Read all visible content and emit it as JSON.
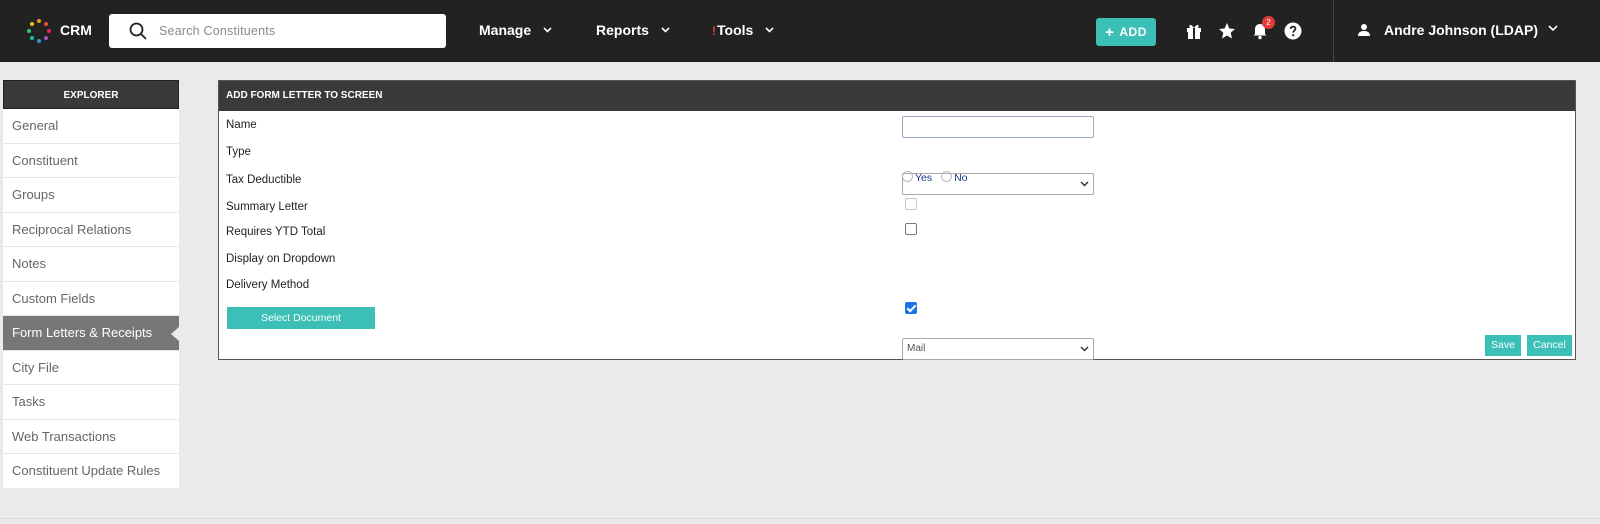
{
  "topbar": {
    "brand": "CRM",
    "search_placeholder": "Search Constituents",
    "nav": [
      {
        "label": "Manage"
      },
      {
        "label": "Reports"
      },
      {
        "label": "Tools",
        "alert_mark": "!"
      }
    ],
    "add_label": "ADD",
    "notification_count": "2",
    "user_name": "Andre Johnson (LDAP)",
    "icons": [
      "gift-icon",
      "star-icon",
      "bell-icon",
      "help-icon",
      "user-icon"
    ]
  },
  "sidebar": {
    "header": "EXPLORER",
    "items": [
      {
        "label": "General"
      },
      {
        "label": "Constituent"
      },
      {
        "label": "Groups"
      },
      {
        "label": "Reciprocal Relations"
      },
      {
        "label": "Notes"
      },
      {
        "label": "Custom Fields"
      },
      {
        "label": "Form Letters & Receipts",
        "active": true
      },
      {
        "label": "City File"
      },
      {
        "label": "Tasks"
      },
      {
        "label": "Web Transactions"
      },
      {
        "label": "Constituent Update Rules"
      }
    ]
  },
  "form": {
    "title": "ADD FORM LETTER TO SCREEN",
    "name_label": "Name",
    "name_value": "",
    "type_label": "Type",
    "type_value": "",
    "tax_label": "Tax Deductible",
    "tax_yes": "Yes",
    "tax_no": "No",
    "summary_label": "Summary Letter",
    "summary_checked": false,
    "ytd_label": "Requires YTD Total",
    "ytd_checked": false,
    "dropdown_label": "Display on Dropdown",
    "dropdown_checked": true,
    "delivery_label": "Delivery Method",
    "delivery_value": "Mail",
    "select_document": "Select Document",
    "save": "Save",
    "cancel": "Cancel"
  },
  "colors": {
    "accent": "#3bbfb6",
    "topbar": "#222222",
    "header": "#3a3a3a",
    "active_item": "#777777",
    "badge": "#e53935"
  }
}
